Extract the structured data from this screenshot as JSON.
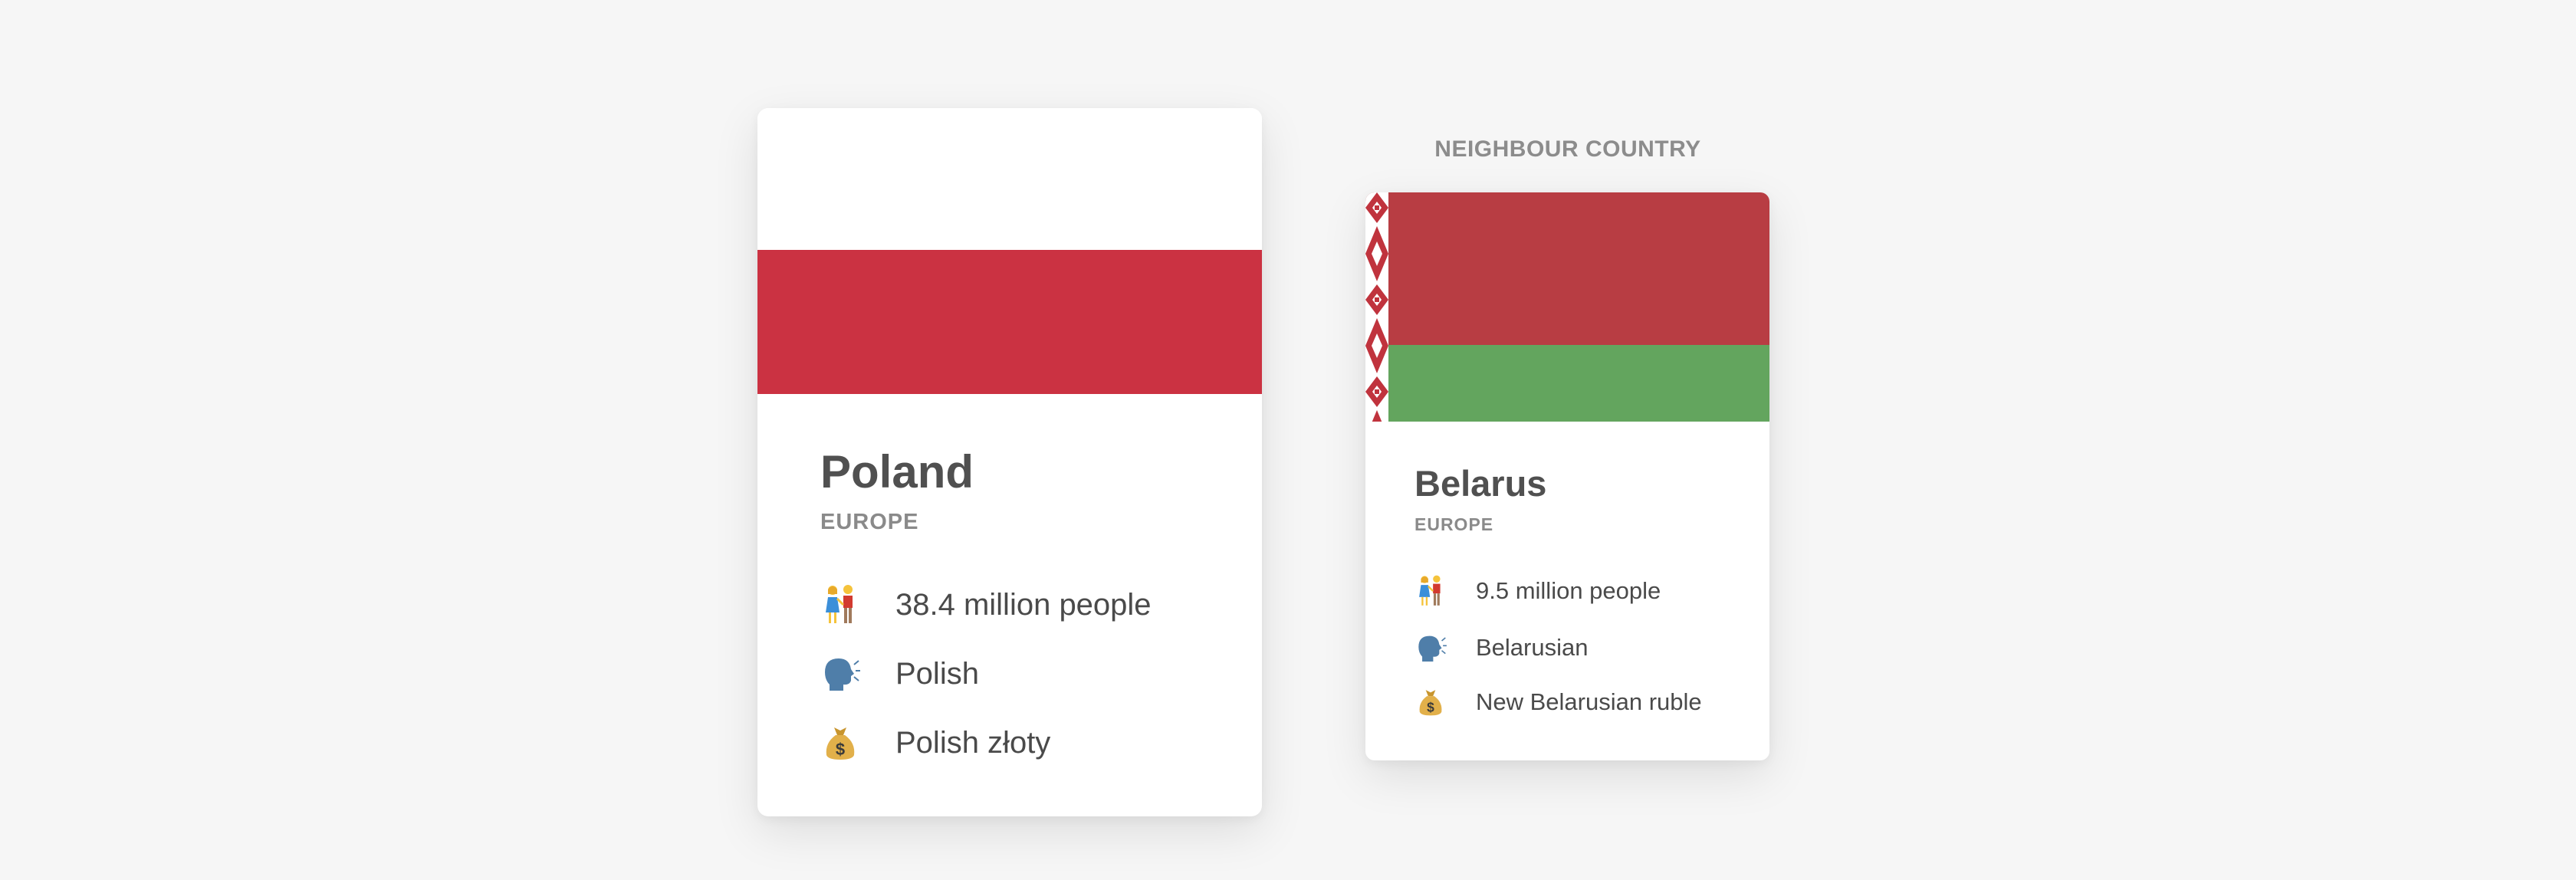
{
  "colors": {
    "poland_white": "#ffffff",
    "poland_red": "#cb3242",
    "belarus_red": "#b83d43",
    "belarus_green": "#63a55e",
    "ornament": "#c0333d"
  },
  "poland": {
    "name": "Poland",
    "region": "EUROPE",
    "facts": [
      {
        "icon": "couple-icon",
        "text": "38.4 million people"
      },
      {
        "icon": "speaking-head-icon",
        "text": "Polish"
      },
      {
        "icon": "money-bag-icon",
        "text": "Polish złoty"
      }
    ]
  },
  "neighbour_label": "NEIGHBOUR COUNTRY",
  "belarus": {
    "name": "Belarus",
    "region": "EUROPE",
    "facts": [
      {
        "icon": "couple-icon",
        "text": "9.5 million people"
      },
      {
        "icon": "speaking-head-icon",
        "text": "Belarusian"
      },
      {
        "icon": "money-bag-icon",
        "text": "New Belarusian ruble"
      }
    ]
  }
}
